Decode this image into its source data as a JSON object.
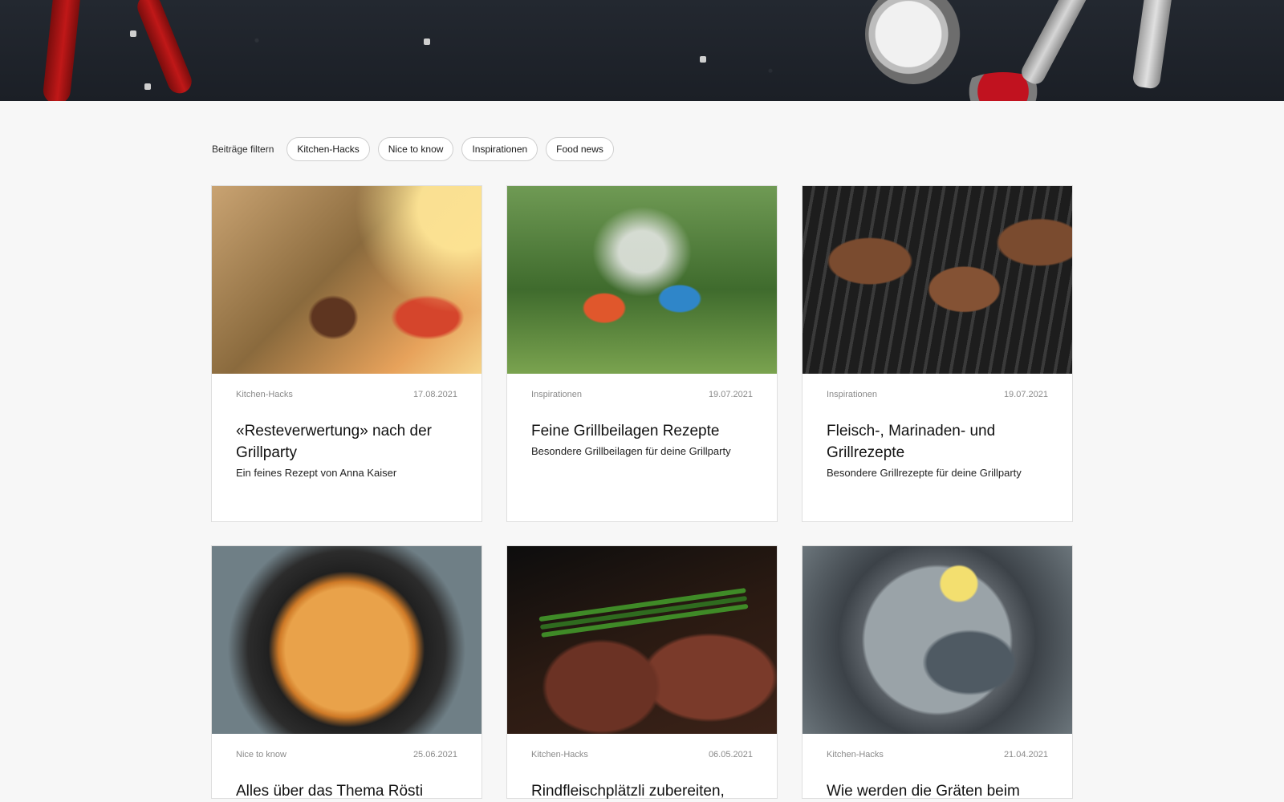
{
  "filters": {
    "label": "Beiträge filtern",
    "chips": [
      "Kitchen-Hacks",
      "Nice to know",
      "Inspirationen",
      "Food news"
    ]
  },
  "cards": [
    {
      "category": "Kitchen-Hacks",
      "date": "17.08.2021",
      "title": "«Resteverwertung» nach der Grillparty",
      "subtitle": "Ein feines Rezept von Anna Kaiser"
    },
    {
      "category": "Inspirationen",
      "date": "19.07.2021",
      "title": "Feine Grillbeilagen Rezepte",
      "subtitle": "Besondere Grillbeilagen für deine Grillparty"
    },
    {
      "category": "Inspirationen",
      "date": "19.07.2021",
      "title": "Fleisch-, Marinaden- und Grillrezepte",
      "subtitle": "Besondere Grillrezepte für deine Grillparty"
    },
    {
      "category": "Nice to know",
      "date": "25.06.2021",
      "title": "Alles über das Thema Rösti",
      "subtitle": ""
    },
    {
      "category": "Kitchen-Hacks",
      "date": "06.05.2021",
      "title": "Rindfleischplätzli zubereiten,",
      "subtitle": ""
    },
    {
      "category": "Kitchen-Hacks",
      "date": "21.04.2021",
      "title": "Wie werden die Gräten beim",
      "subtitle": ""
    }
  ]
}
